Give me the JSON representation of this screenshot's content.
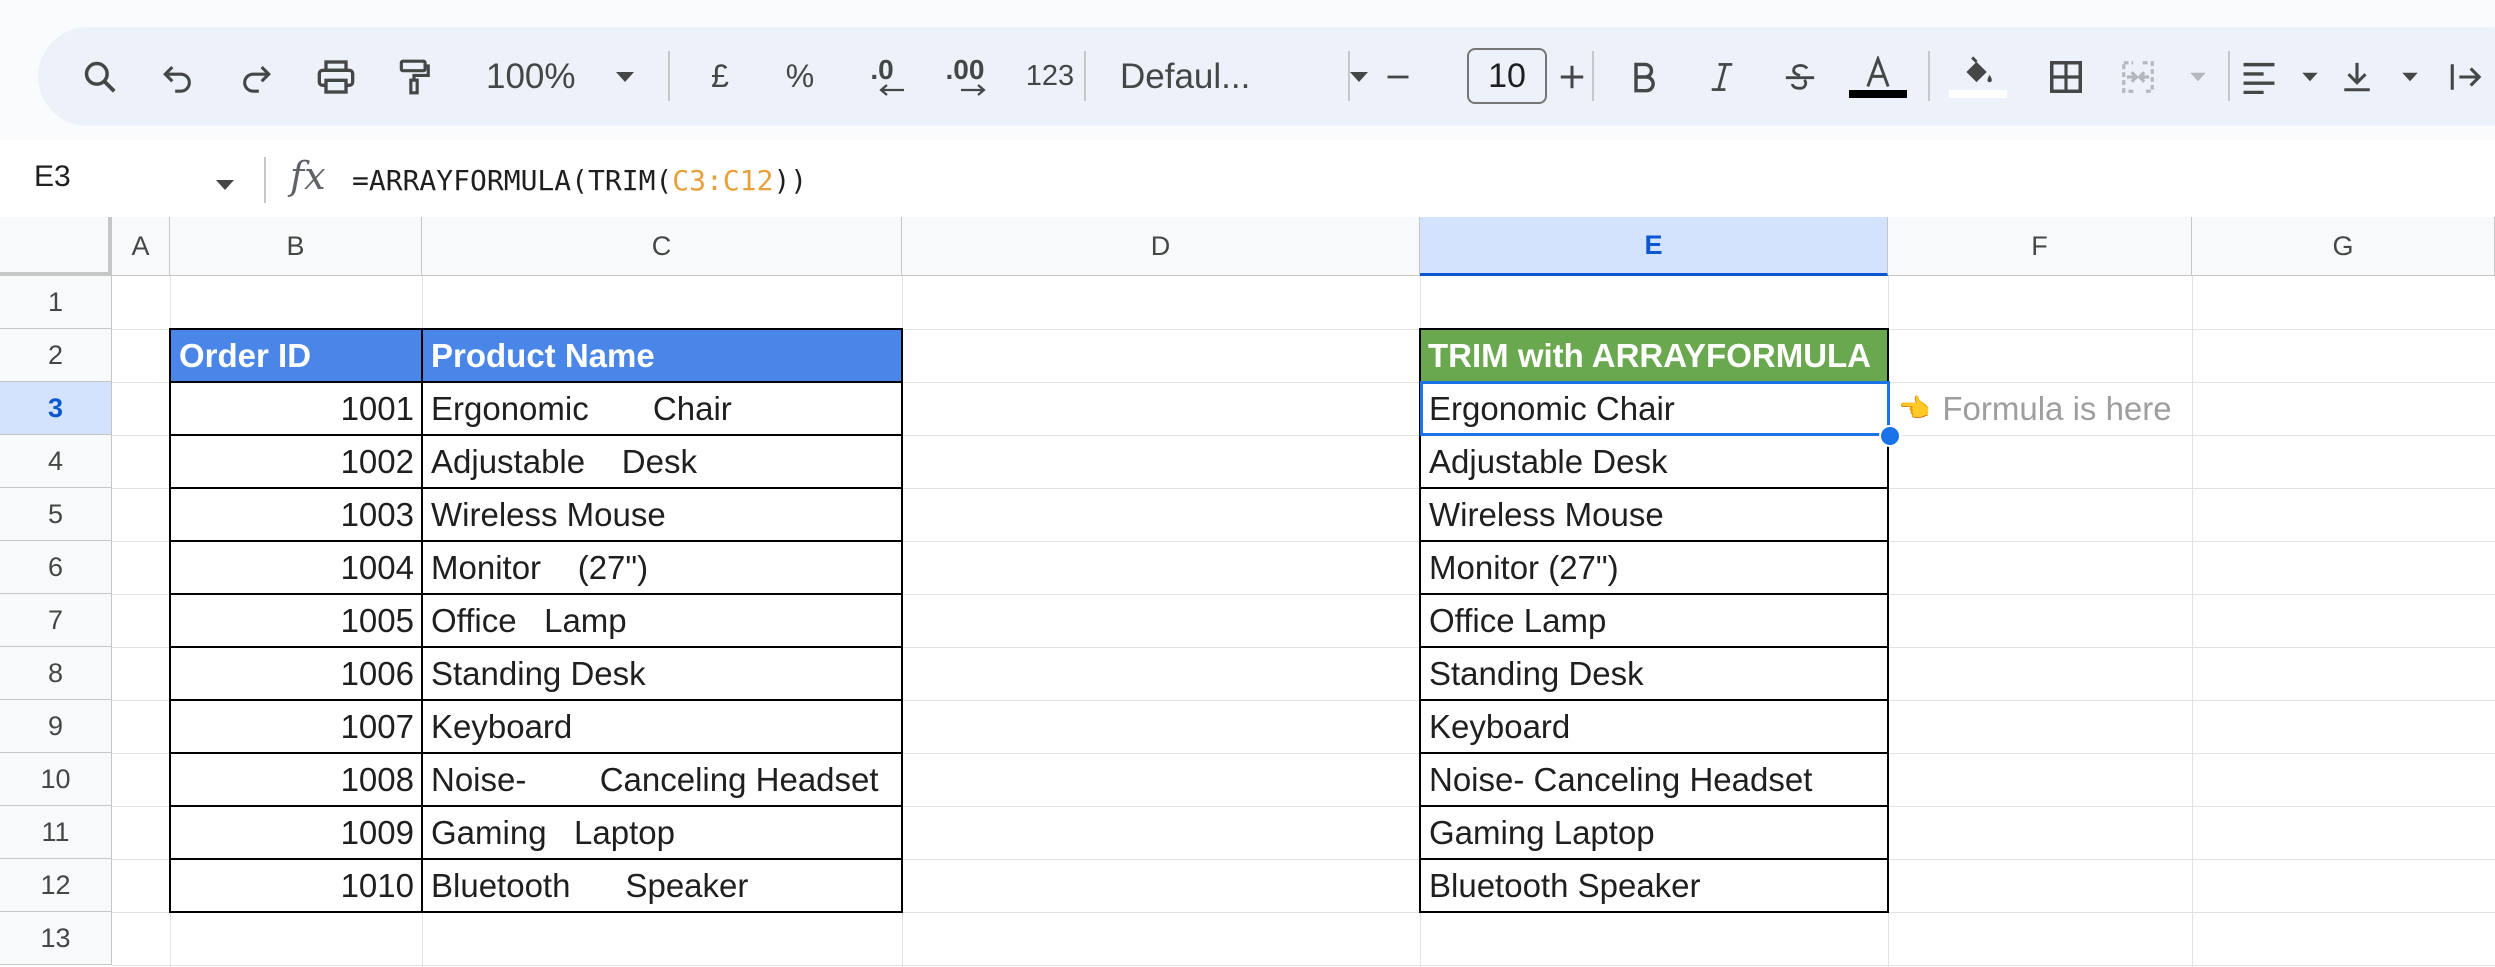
{
  "toolbar": {
    "zoom": "100%",
    "currency": "£",
    "percent": "%",
    "decrease_decimal": ".0",
    "increase_decimal": ".00",
    "number_format": "123",
    "font": "Defaul...",
    "font_size": "10"
  },
  "formula_bar": {
    "name_box": "E3",
    "fx": "fx",
    "formula_prefix": "=ARRAYFORMULA(TRIM(",
    "formula_ref": "C3:C12",
    "formula_suffix": "))"
  },
  "columns": [
    "A",
    "B",
    "C",
    "D",
    "E",
    "F",
    "G"
  ],
  "selected_column": "E",
  "rows": [
    "1",
    "2",
    "3",
    "4",
    "5",
    "6",
    "7",
    "8",
    "9",
    "10",
    "11",
    "12",
    "13"
  ],
  "selected_row": "3",
  "table": {
    "header_id": "Order ID",
    "header_name": "Product Name",
    "header_trim": "TRIM with ARRAYFORMULA",
    "ids": [
      "1001",
      "1002",
      "1003",
      "1004",
      "1005",
      "1006",
      "1007",
      "1008",
      "1009",
      "1010"
    ],
    "names": [
      "Ergonomic       Chair",
      "Adjustable    Desk",
      "Wireless Mouse",
      "Monitor    (27\")",
      "Office   Lamp",
      "Standing Desk",
      "Keyboard",
      "Noise-        Canceling Headset",
      "Gaming   Laptop",
      "Bluetooth      Speaker"
    ],
    "trimmed": [
      "Ergonomic Chair",
      "Adjustable Desk",
      "Wireless Mouse",
      "Monitor (27\")",
      "Office Lamp",
      "Standing Desk",
      "Keyboard",
      "Noise- Canceling Headset",
      "Gaming Laptop",
      "Bluetooth Speaker"
    ]
  },
  "note": {
    "emoji": "👈",
    "text": "Formula is here"
  },
  "colors": {
    "header_blue": "#4a86e8",
    "header_green": "#6aa84f",
    "selection": "#1a73e8",
    "formula_ref": "#e8a13a"
  }
}
